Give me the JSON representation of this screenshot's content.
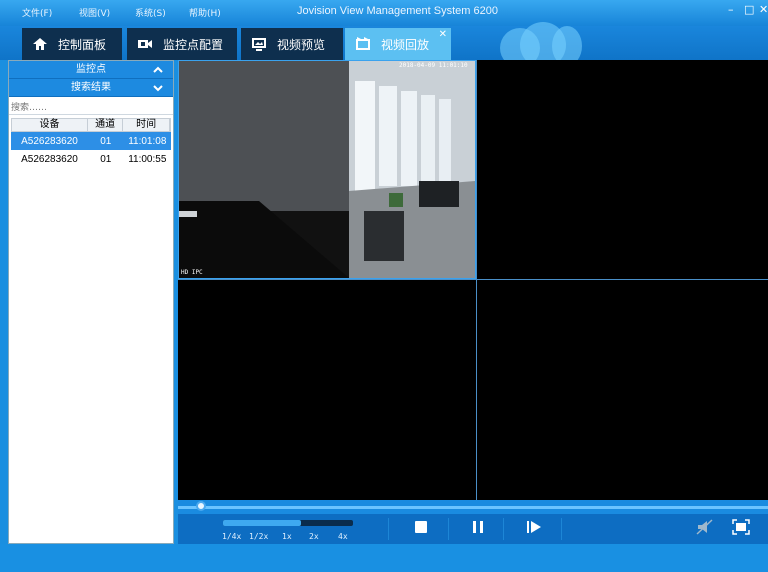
{
  "titlebar": {
    "menus": [
      "文件(F)",
      "视图(V)",
      "系统(S)",
      "帮助(H)"
    ],
    "title": "Jovision View Management System 6200",
    "window_buttons": [
      "–",
      "□",
      "✕"
    ]
  },
  "tabs": [
    {
      "label": "控制面板",
      "icon": "home-icon"
    },
    {
      "label": "监控点配置",
      "icon": "camera-icon"
    },
    {
      "label": "视频预览",
      "icon": "monitor-icon"
    },
    {
      "label": "视频回放",
      "icon": "playback-icon",
      "active": true,
      "close": "✕"
    }
  ],
  "sidebar": {
    "monitor_points_header": "监控点",
    "search_results_header": "搜索结果",
    "search_placeholder": "搜索……",
    "columns": [
      "设备",
      "通道",
      "时间"
    ],
    "rows": [
      {
        "device": "A526283620",
        "channel": "01",
        "time": "11:01:08",
        "selected": true
      },
      {
        "device": "A526283620",
        "channel": "01",
        "time": "11:00:55",
        "selected": false
      }
    ]
  },
  "video": {
    "cam_label": "HD IPC",
    "timestamp": "2018-04-09 11:01:10"
  },
  "controls": {
    "speeds": [
      "1/4x",
      "1/2x",
      "1x",
      "2x",
      "4x"
    ],
    "playback_progress": 0.03,
    "speed_level": 0.6
  },
  "colors": {
    "accent": "#1a8fe0",
    "selected_row": "#2d8fe6",
    "tab_active": "#5cc0f2"
  }
}
